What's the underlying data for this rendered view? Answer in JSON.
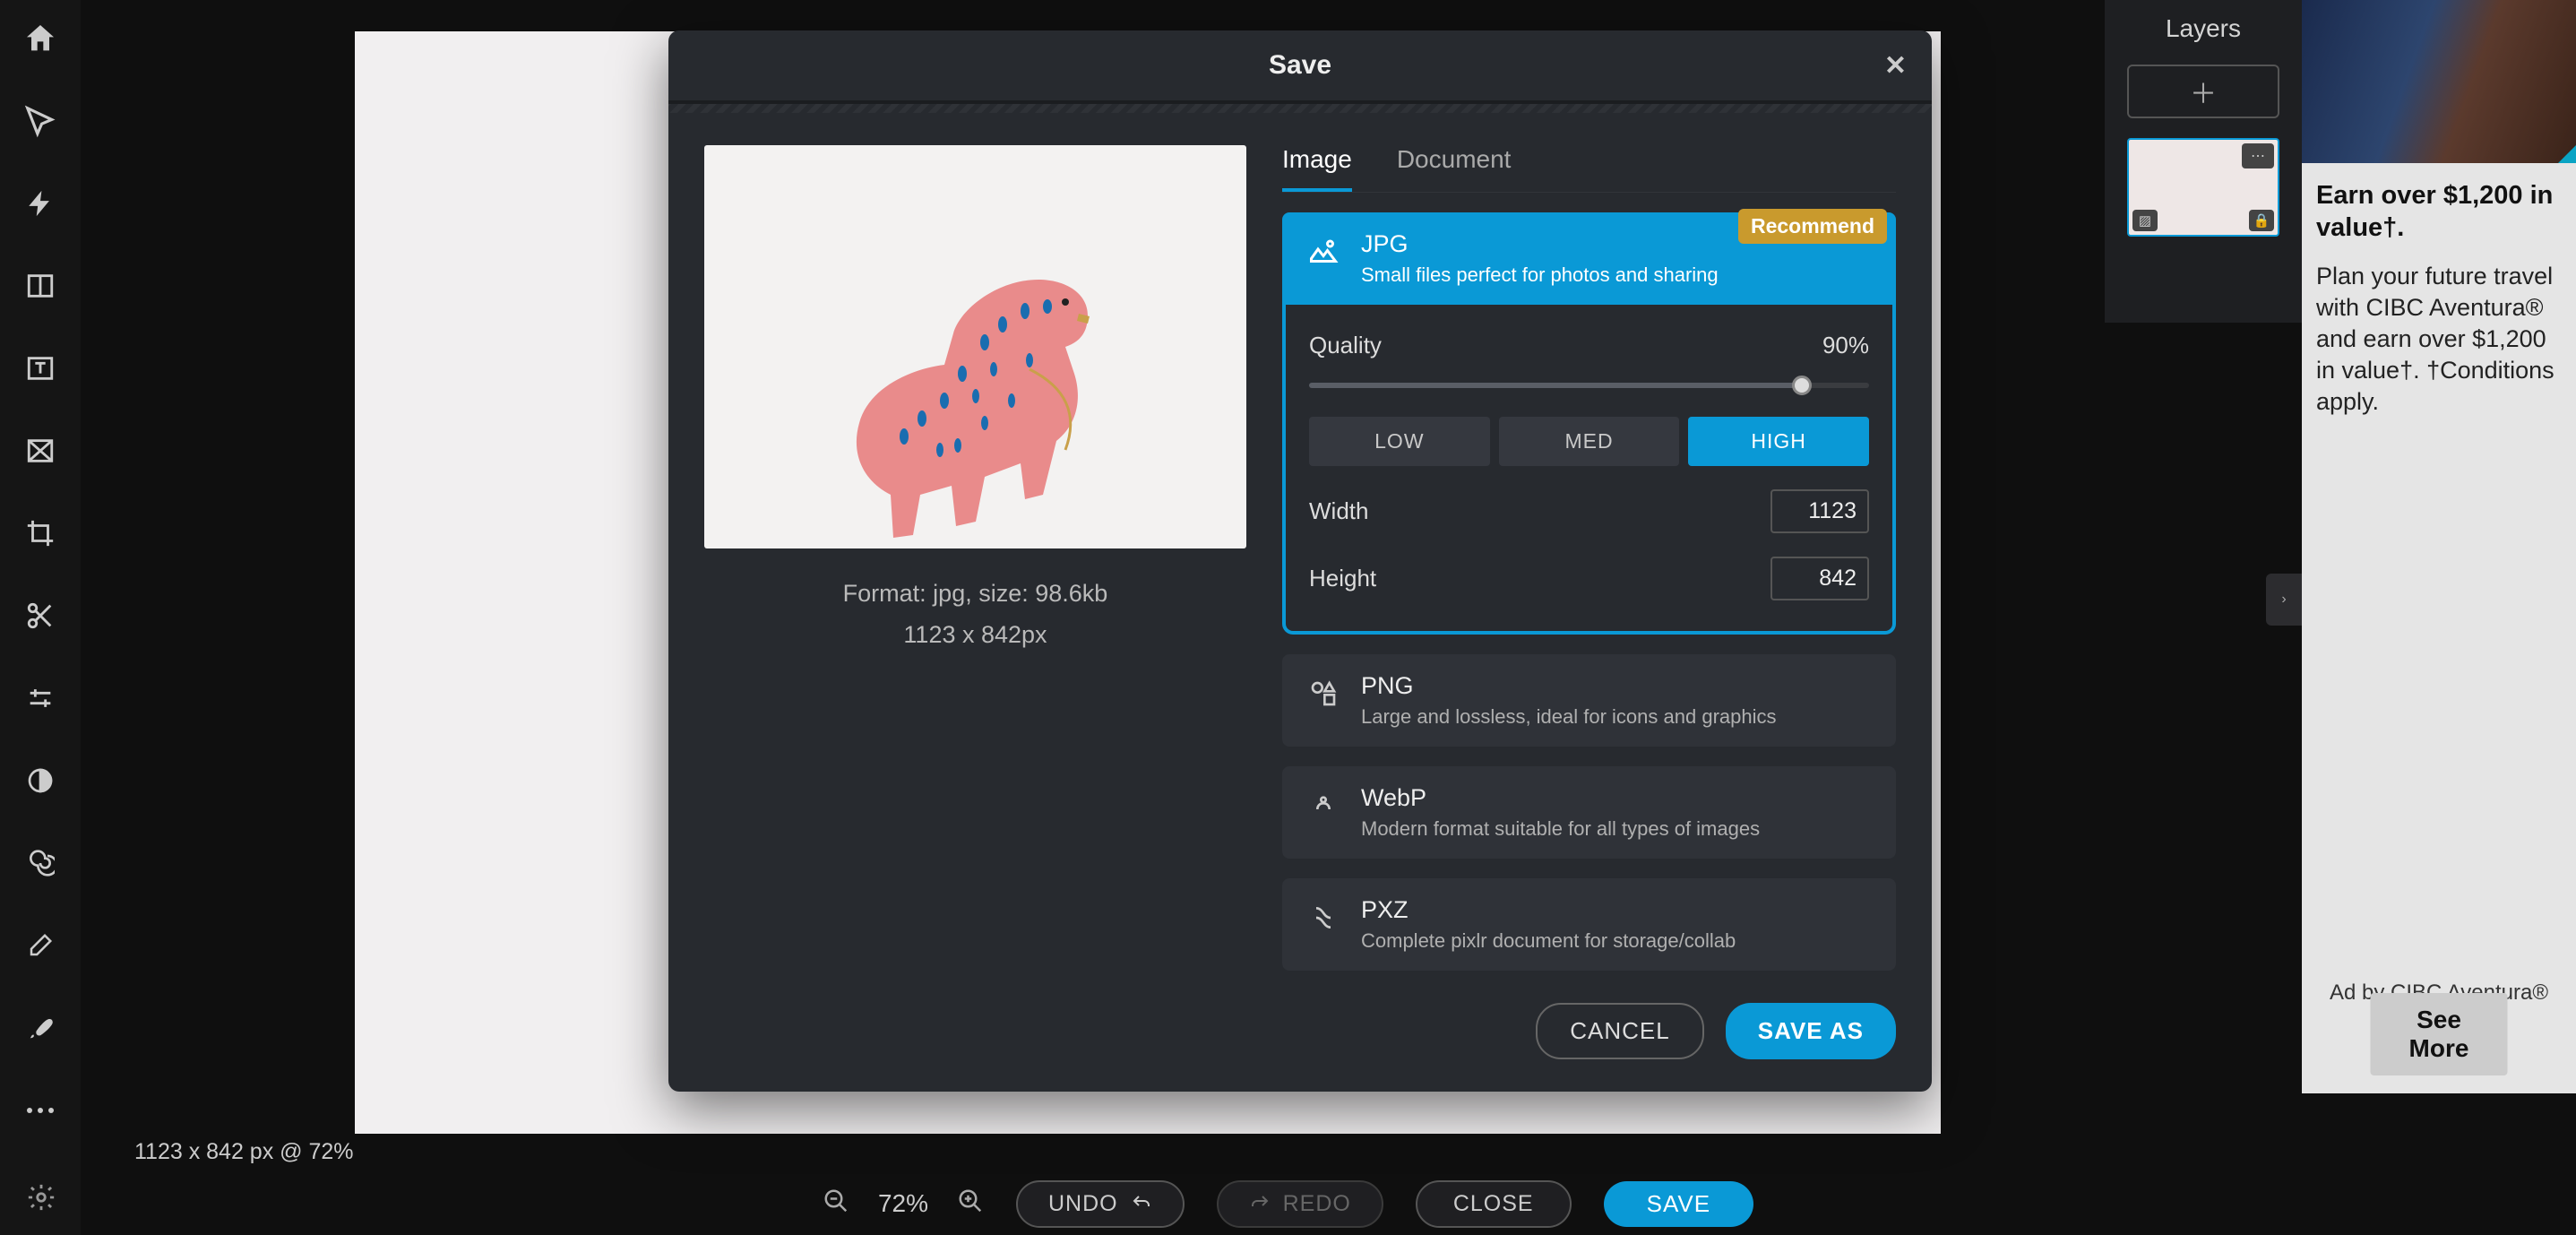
{
  "status_bar": {
    "text": "1123 x 842 px @ 72%"
  },
  "bottom_bar": {
    "zoom": "72%",
    "undo": "UNDO",
    "redo": "REDO",
    "close": "CLOSE",
    "save": "SAVE"
  },
  "layers": {
    "title": "Layers"
  },
  "ad": {
    "headline": "Earn over $1,200 in value†.",
    "body": "Plan your future travel with CIBC Aventura® and earn over $1,200 in value†. †Conditions apply.",
    "attrib": "Ad by CIBC Aventura®",
    "cta": "See More"
  },
  "modal": {
    "title": "Save",
    "tabs": {
      "image": "Image",
      "document": "Document"
    },
    "preview": {
      "format_line": "Format: jpg, size: 98.6kb",
      "dimensions_line": "1123 x 842px"
    },
    "formats": {
      "jpg": {
        "title": "JPG",
        "desc": "Small files perfect for photos and sharing",
        "recommend": "Recommend"
      },
      "png": {
        "title": "PNG",
        "desc": "Large and lossless, ideal for icons and graphics"
      },
      "webp": {
        "title": "WebP",
        "desc": "Modern format suitable for all types of images"
      },
      "pxz": {
        "title": "PXZ",
        "desc": "Complete pixlr document for storage/collab"
      }
    },
    "quality": {
      "label": "Quality",
      "value": "90%",
      "low": "LOW",
      "med": "MED",
      "high": "HIGH"
    },
    "dimensions": {
      "width_label": "Width",
      "width_value": "1123",
      "height_label": "Height",
      "height_value": "842"
    },
    "footer": {
      "cancel": "CANCEL",
      "save_as": "SAVE AS"
    }
  }
}
